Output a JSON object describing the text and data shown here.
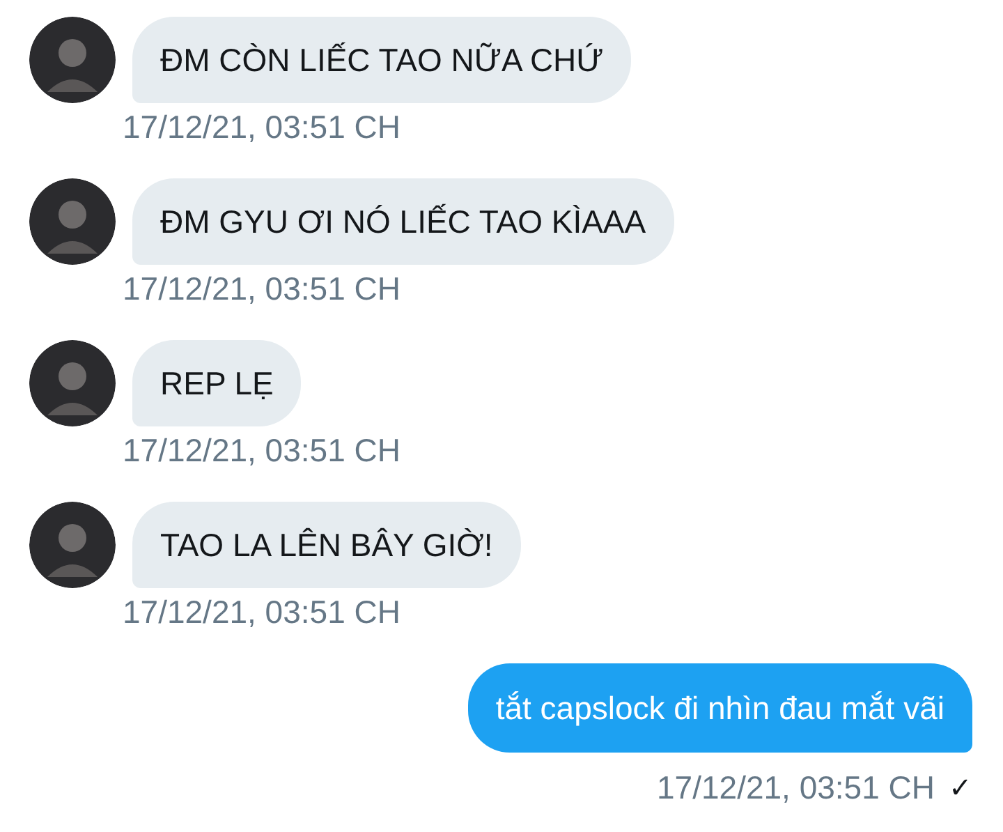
{
  "messages": [
    {
      "kind": "received",
      "text": "ĐM CÒN LIẾC TAO NỮA CHỨ",
      "time": "17/12/21, 03:51 CH"
    },
    {
      "kind": "received",
      "text": "ĐM GYU ƠI NÓ LIẾC TAO KÌAAA",
      "time": "17/12/21, 03:51 CH"
    },
    {
      "kind": "received",
      "text": "REP LẸ",
      "time": "17/12/21, 03:51 CH"
    },
    {
      "kind": "received",
      "text": "TAO LA LÊN BÂY GIỜ!",
      "time": "17/12/21, 03:51 CH"
    },
    {
      "kind": "sent",
      "text": "tắt capslock đi nhìn đau mắt vãi",
      "time": "17/12/21, 03:51 CH",
      "receipt": "✓"
    }
  ]
}
